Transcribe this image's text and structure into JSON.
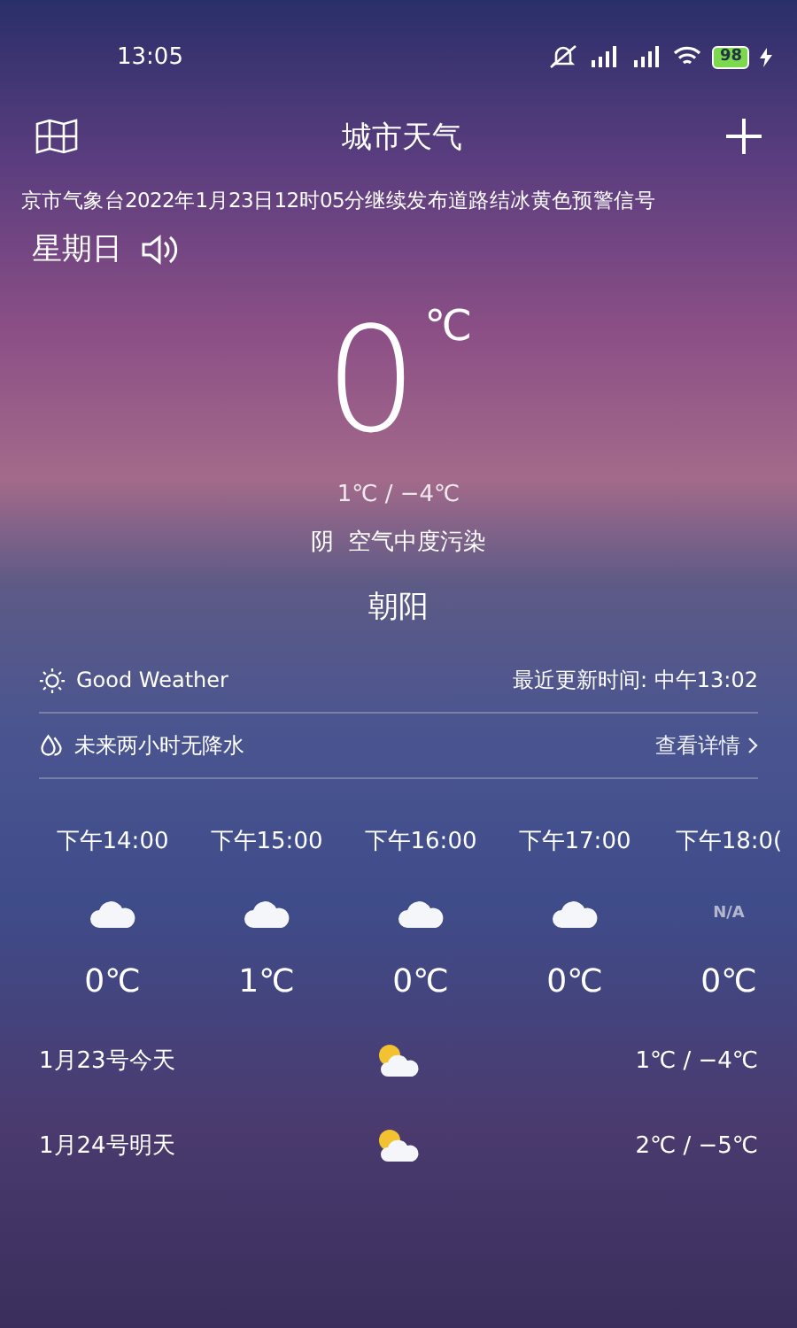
{
  "status_bar": {
    "time": "13:05",
    "battery": "98",
    "charging": true
  },
  "header": {
    "title": "城市天气"
  },
  "alert": "京市气象台2022年1月23日12时05分继续发布道路结冰黄色预警信号",
  "weekday": "星期日",
  "current": {
    "temp": "0",
    "unit": "℃",
    "range": "1℃ / −4℃",
    "condition": "阴  空气中度污染",
    "location": "朝阳"
  },
  "info_rows": [
    {
      "kind": "sun",
      "text": "Good Weather",
      "right": "最近更新时间: 中午13:02",
      "link": false
    },
    {
      "kind": "drop",
      "text": "未来两小时无降水",
      "right": "查看详情",
      "link": true
    }
  ],
  "hourly": [
    {
      "time": "下午14:00",
      "kind": "cloud",
      "temp": "0℃"
    },
    {
      "time": "下午15:00",
      "kind": "cloud",
      "temp": "1℃"
    },
    {
      "time": "下午16:00",
      "kind": "cloud",
      "temp": "0℃"
    },
    {
      "time": "下午17:00",
      "kind": "cloud",
      "temp": "0℃"
    },
    {
      "time": "下午18:0(",
      "kind": "na",
      "label": "N/A",
      "temp": "0℃"
    }
  ],
  "daily": [
    {
      "date": "1月23号今天",
      "range": "1℃ / −4℃"
    },
    {
      "date": "1月24号明天",
      "range": "2℃ / −5℃"
    }
  ]
}
